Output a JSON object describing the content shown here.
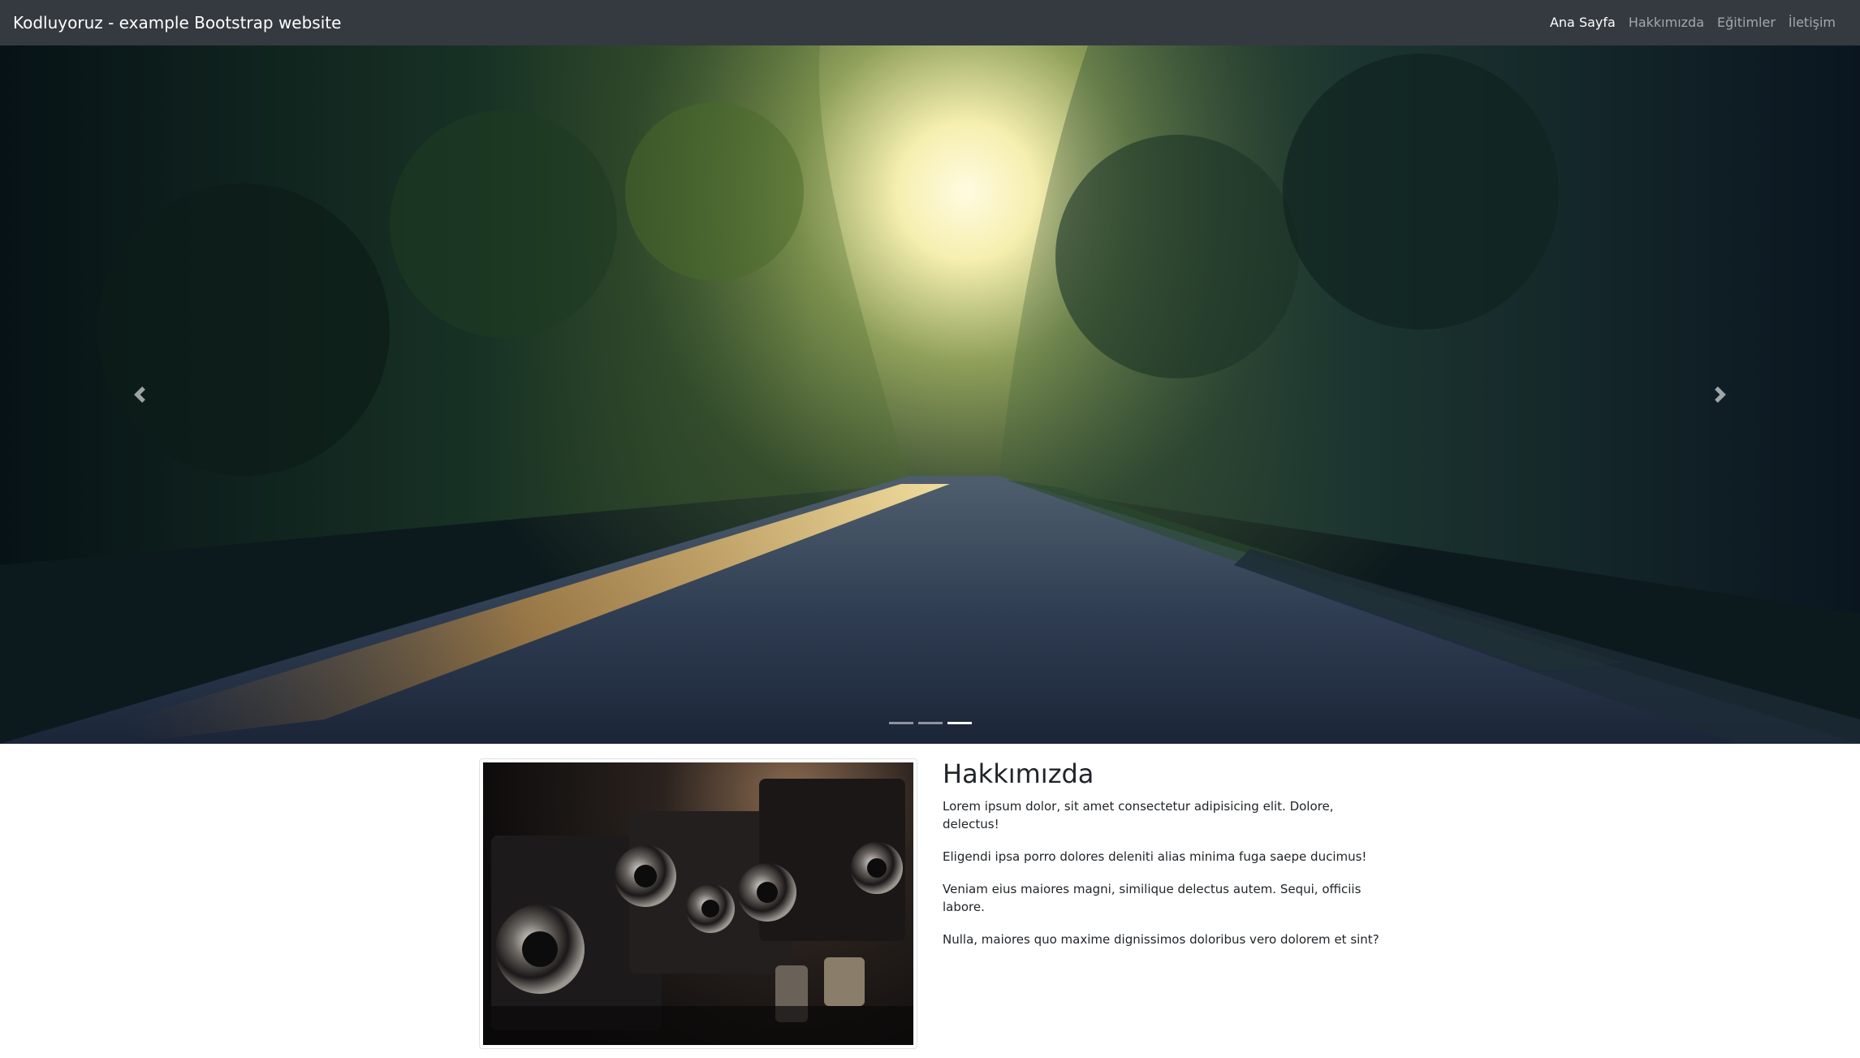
{
  "navbar": {
    "brand": "Kodluyoruz - example Bootstrap website",
    "links": [
      {
        "label": "Ana Sayfa",
        "active": true
      },
      {
        "label": "Hakkımızda",
        "active": false
      },
      {
        "label": "Eğitimler",
        "active": false
      },
      {
        "label": "İletişim",
        "active": false
      }
    ]
  },
  "carousel": {
    "slides": 3,
    "active_index": 2,
    "image_subject": "tree-lined road at sunrise"
  },
  "about": {
    "title": "Hakkımızda",
    "image_subject": "vintage cameras",
    "paragraphs": [
      "Lorem ipsum dolor, sit amet consectetur adipisicing elit. Dolore, delectus!",
      "Eligendi ipsa porro dolores deleniti alias minima fuga saepe ducimus!",
      "Veniam eius maiores magni, similique delectus autem. Sequi, officiis labore.",
      "Nulla, maiores quo maxime dignissimos doloribus vero dolorem et sint?"
    ]
  },
  "colors": {
    "navbar_bg": "#343a40",
    "nav_active": "#ffffff",
    "nav_inactive": "rgba(255,255,255,0.55)"
  }
}
